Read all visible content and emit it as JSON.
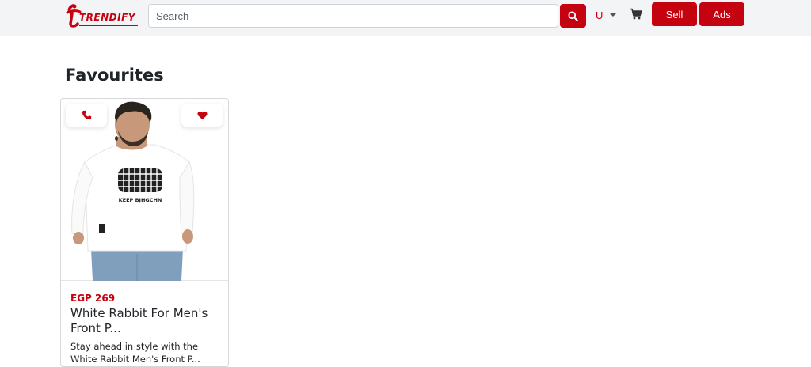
{
  "header": {
    "logo_text": "TRENDIFY",
    "search": {
      "placeholder": "Search",
      "value": ""
    },
    "user_label": "U",
    "sell_label": "Sell",
    "ads_label": "Ads"
  },
  "main": {
    "title": "Favourites",
    "favourites": [
      {
        "price": "EGP 269",
        "title": "White Rabbit For Men's Front P...",
        "description": "Stay ahead in style with the White Rabbit Men's Front P...",
        "image_print": "KEEP BJHGCHN"
      }
    ]
  },
  "icons": {
    "search": "search-icon",
    "cart": "cart-icon",
    "phone": "phone-icon",
    "heart": "heart-icon",
    "caret": "chevron-down-icon"
  },
  "colors": {
    "brand": "#c5020f",
    "header_bg": "#f3f4f6"
  }
}
